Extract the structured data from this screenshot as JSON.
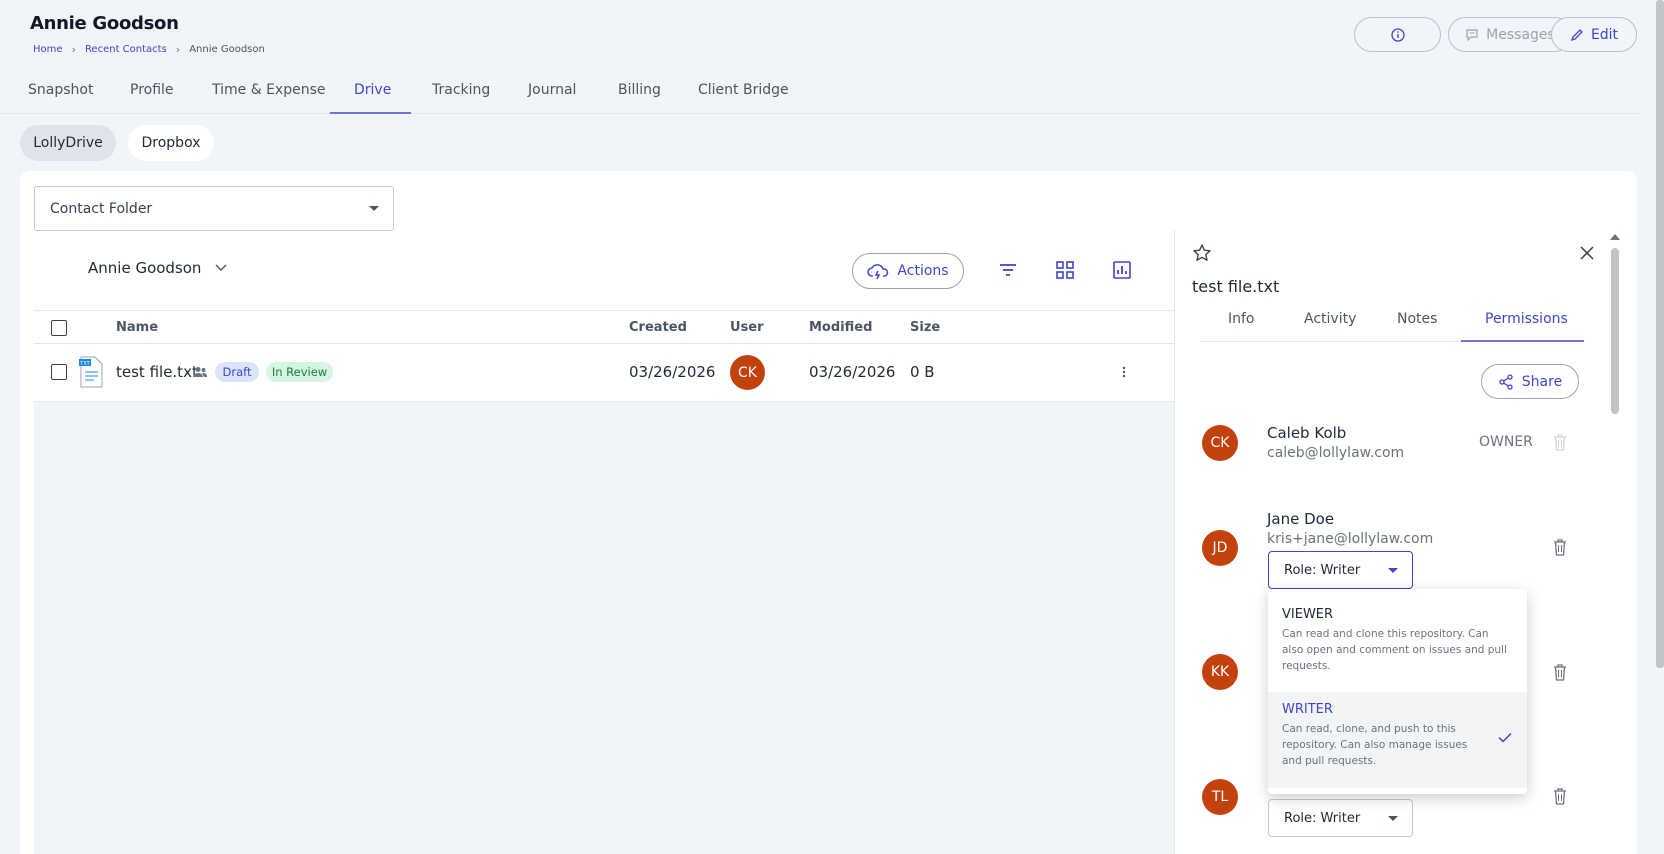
{
  "header": {
    "title": "Annie Goodson",
    "breadcrumb": [
      "Home",
      "Recent Contacts",
      "Annie Goodson"
    ],
    "buttons": {
      "messages": "Messages",
      "edit": "Edit"
    }
  },
  "tabs": [
    "Snapshot",
    "Profile",
    "Time & Expense",
    "Drive",
    "Tracking",
    "Journal",
    "Billing",
    "Client Bridge"
  ],
  "active_tab": "Drive",
  "drive_sources": [
    "LollyDrive",
    "Dropbox"
  ],
  "folder_select": {
    "value": "Contact Folder"
  },
  "owner_select": {
    "value": "Annie Goodson"
  },
  "toolbar": {
    "actions": "Actions"
  },
  "table": {
    "columns": [
      "Name",
      "Created",
      "User",
      "Modified",
      "Size"
    ],
    "rows": [
      {
        "name": "test file.txt",
        "badges": [
          "Draft",
          "In Review"
        ],
        "created": "03/26/2026",
        "user": "CK",
        "modified": "03/26/2026",
        "size": "0 B"
      }
    ]
  },
  "panel": {
    "file_name": "test file.txt",
    "tabs": [
      "Info",
      "Activity",
      "Notes",
      "Permissions"
    ],
    "active_tab": "Permissions",
    "share": "Share",
    "people": [
      {
        "initials": "CK",
        "name": "Caleb Kolb",
        "email": "caleb@lollylaw.com",
        "role_label": "OWNER"
      },
      {
        "initials": "JD",
        "name": "Jane Doe",
        "email": "kris+jane@lollylaw.com",
        "role": "Role: Writer"
      },
      {
        "initials": "KK"
      },
      {
        "initials": "TL",
        "role": "Role: Writer"
      }
    ],
    "role_menu": [
      {
        "title": "VIEWER",
        "desc": "Can read and clone this repository. Can also open and comment on issues and pull requests.",
        "selected": false
      },
      {
        "title": "WRITER",
        "desc": "Can read, clone, and push to this repository. Can also manage issues and pull requests.",
        "selected": true
      }
    ]
  },
  "colors": {
    "accent": "#3e46c9",
    "avatar": "#c2410c",
    "draft_bg": "#dbe4fb",
    "review_bg": "#d7f4e3"
  }
}
